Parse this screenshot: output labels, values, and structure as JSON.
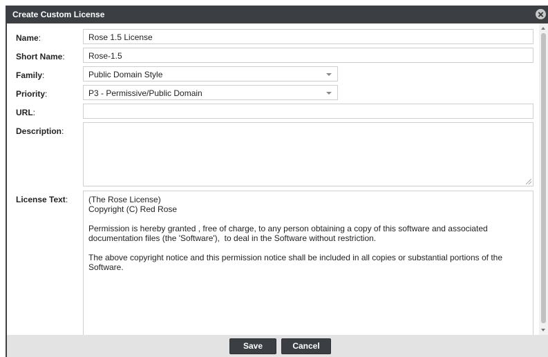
{
  "dialog": {
    "title": "Create Custom License"
  },
  "form": {
    "name": {
      "label": "Name",
      "value": "Rose 1.5 License"
    },
    "short_name": {
      "label": "Short Name",
      "value": "Rose-1.5"
    },
    "family": {
      "label": "Family",
      "value": "Public Domain Style"
    },
    "priority": {
      "label": "Priority",
      "value": "P3 - Permissive/Public Domain"
    },
    "url": {
      "label": "URL",
      "value": ""
    },
    "description": {
      "label": "Description",
      "value": ""
    },
    "license_text": {
      "label": "License Text",
      "value": "(The Rose License)\nCopyright (C) Red Rose\n\nPermission is hereby granted , free of charge, to any person obtaining a copy of this software and associated\ndocumentation files (the 'Software'),  to deal in the Software without restriction.\n\nThe above copyright notice and this permission notice shall be included in all copies or substantial portions of the\nSoftware."
    }
  },
  "footer": {
    "save_label": "Save",
    "cancel_label": "Cancel"
  },
  "icons": {
    "close": "close-circle-icon",
    "dropdown": "chevron-down-icon",
    "resize": "resize-grip-icon"
  },
  "colors": {
    "titlebar": "#3b3f44",
    "button": "#3b3f44",
    "footer": "#e3e3e3",
    "field_border": "#cfcfcf"
  }
}
